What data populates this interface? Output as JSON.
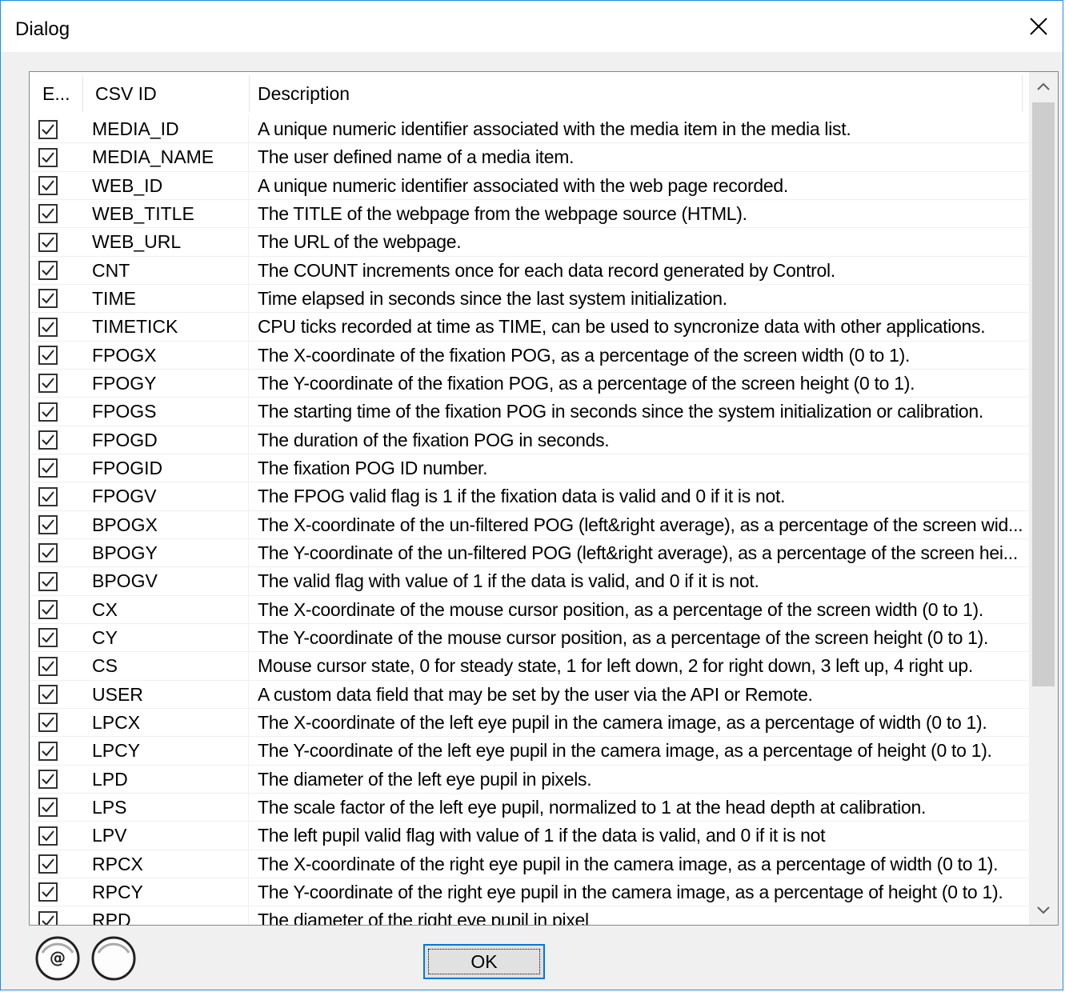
{
  "window": {
    "title": "Dialog"
  },
  "table": {
    "headers": [
      "E...",
      "CSV ID",
      "Description"
    ],
    "rows": [
      {
        "checked": true,
        "id": "MEDIA_ID",
        "desc": "A unique numeric identifier associated with the media item in the media list."
      },
      {
        "checked": true,
        "id": "MEDIA_NAME",
        "desc": "The user defined name of a media item."
      },
      {
        "checked": true,
        "id": "WEB_ID",
        "desc": "A unique numeric identifier associated with the web page recorded."
      },
      {
        "checked": true,
        "id": "WEB_TITLE",
        "desc": "The TITLE of the webpage from the webpage source (HTML)."
      },
      {
        "checked": true,
        "id": "WEB_URL",
        "desc": "The URL of the webpage."
      },
      {
        "checked": true,
        "id": "CNT",
        "desc": "The COUNT increments once for each data record generated by Control."
      },
      {
        "checked": true,
        "id": "TIME",
        "desc": "Time elapsed in seconds since the last system initialization."
      },
      {
        "checked": true,
        "id": "TIMETICK",
        "desc": "CPU ticks recorded at time as TIME, can be used to syncronize data with other applications."
      },
      {
        "checked": true,
        "id": "FPOGX",
        "desc": "The X-coordinate of the fixation POG, as a percentage of the screen width (0 to 1)."
      },
      {
        "checked": true,
        "id": "FPOGY",
        "desc": "The Y-coordinate of the fixation POG, as a percentage of the screen height (0 to 1)."
      },
      {
        "checked": true,
        "id": "FPOGS",
        "desc": "The starting time of the fixation POG in seconds since the system initialization or calibration."
      },
      {
        "checked": true,
        "id": "FPOGD",
        "desc": "The duration of the fixation POG in seconds."
      },
      {
        "checked": true,
        "id": "FPOGID",
        "desc": "The fixation POG ID number."
      },
      {
        "checked": true,
        "id": "FPOGV",
        "desc": "The FPOG valid flag is 1 if the fixation data is valid and 0 if it is not."
      },
      {
        "checked": true,
        "id": "BPOGX",
        "desc": "The X-coordinate of the un-filtered POG (left&right average), as a percentage of the screen wid..."
      },
      {
        "checked": true,
        "id": "BPOGY",
        "desc": "The Y-coordinate of the un-filtered POG (left&right average), as a percentage of the screen hei..."
      },
      {
        "checked": true,
        "id": "BPOGV",
        "desc": "The valid flag with value of 1 if the data is valid, and 0 if it is not."
      },
      {
        "checked": true,
        "id": "CX",
        "desc": "The X-coordinate of the mouse cursor position, as a percentage of the screen width (0 to 1)."
      },
      {
        "checked": true,
        "id": "CY",
        "desc": "The Y-coordinate of the mouse cursor position, as a percentage of the screen height (0 to 1)."
      },
      {
        "checked": true,
        "id": "CS",
        "desc": "Mouse cursor state, 0 for steady state, 1 for left down, 2 for right down, 3 left up, 4 right up."
      },
      {
        "checked": true,
        "id": "USER",
        "desc": "A custom data field that may be set by the user via the API or Remote."
      },
      {
        "checked": true,
        "id": "LPCX",
        "desc": "The X-coordinate of the left eye pupil in the camera image, as a percentage of width (0 to 1)."
      },
      {
        "checked": true,
        "id": "LPCY",
        "desc": "The Y-coordinate of the left eye pupil in the camera image, as a percentage of height (0 to 1)."
      },
      {
        "checked": true,
        "id": "LPD",
        "desc": "The diameter of the left eye pupil in pixels."
      },
      {
        "checked": true,
        "id": "LPS",
        "desc": "The scale factor of the left eye pupil, normalized to 1 at the head depth at calibration."
      },
      {
        "checked": true,
        "id": "LPV",
        "desc": "The left pupil valid flag with value of 1 if the data is valid, and 0 if it is not"
      },
      {
        "checked": true,
        "id": "RPCX",
        "desc": "The X-coordinate of the right eye pupil in the camera image, as a percentage of width (0 to 1)."
      },
      {
        "checked": true,
        "id": "RPCY",
        "desc": "The Y-coordinate of the right eye pupil in the camera image, as a percentage of height (0 to 1)."
      },
      {
        "checked": true,
        "id": "RPD",
        "desc": "The diameter of the right eye pupil in pixel"
      }
    ]
  },
  "footer": {
    "icon_a": "at-sign-icon",
    "icon_b": "circle-icon",
    "ok_label": "OK"
  }
}
